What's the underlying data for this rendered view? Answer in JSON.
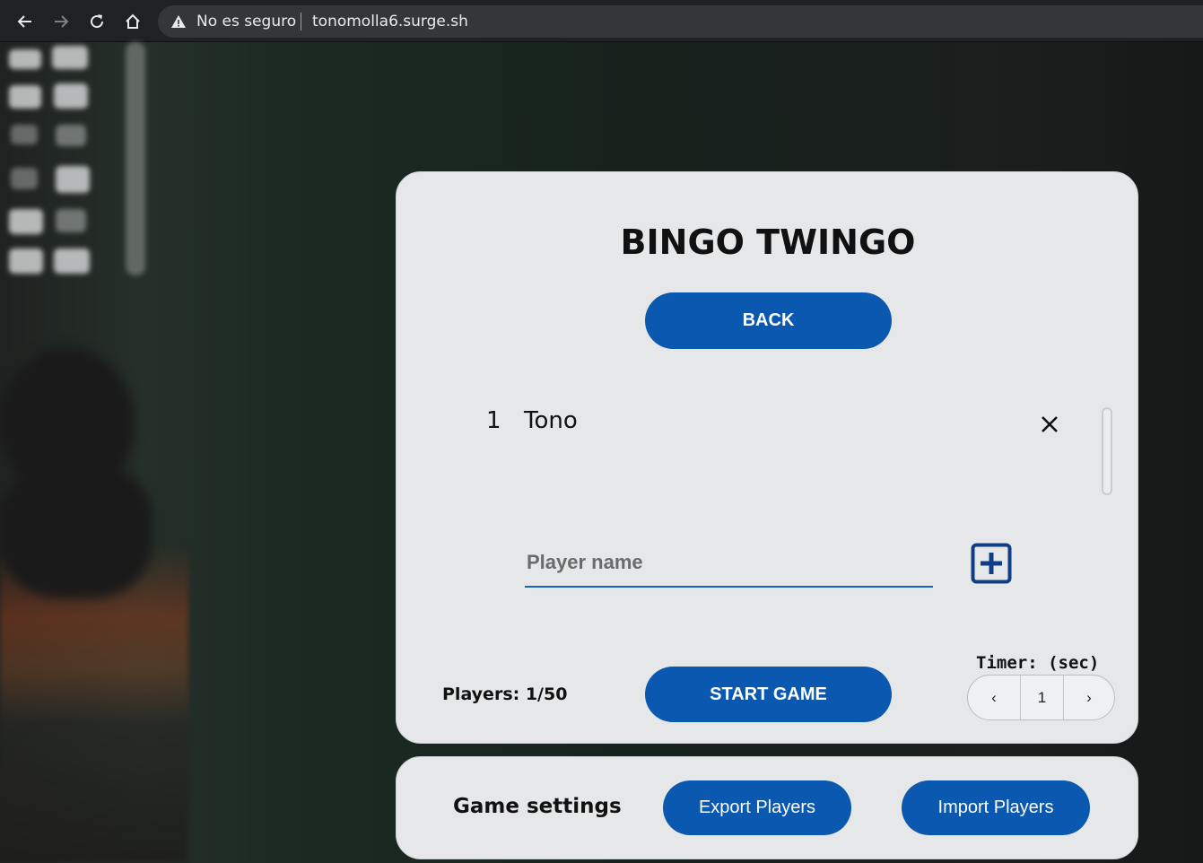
{
  "browser": {
    "security_text": "No es seguro",
    "url": "tonomolla6.surge.sh"
  },
  "card": {
    "title": "BINGO TWINGO",
    "back_label": "BACK",
    "players": [
      {
        "number": "1",
        "name": "Tono"
      }
    ],
    "name_input": {
      "placeholder": "Player name",
      "value": ""
    },
    "players_count": "Players: 1/50",
    "start_label": "START GAME",
    "timer": {
      "label": "Timer: (sec)",
      "prev": "‹",
      "value": "1",
      "next": "›"
    }
  },
  "settings": {
    "label": "Game settings",
    "export_label": "Export Players",
    "import_label": "Import Players"
  },
  "colors": {
    "accent": "#0a58b0",
    "card_bg": "#e6e7e8",
    "input_underline": "#1463c4",
    "add_icon": "#0e3f86"
  }
}
